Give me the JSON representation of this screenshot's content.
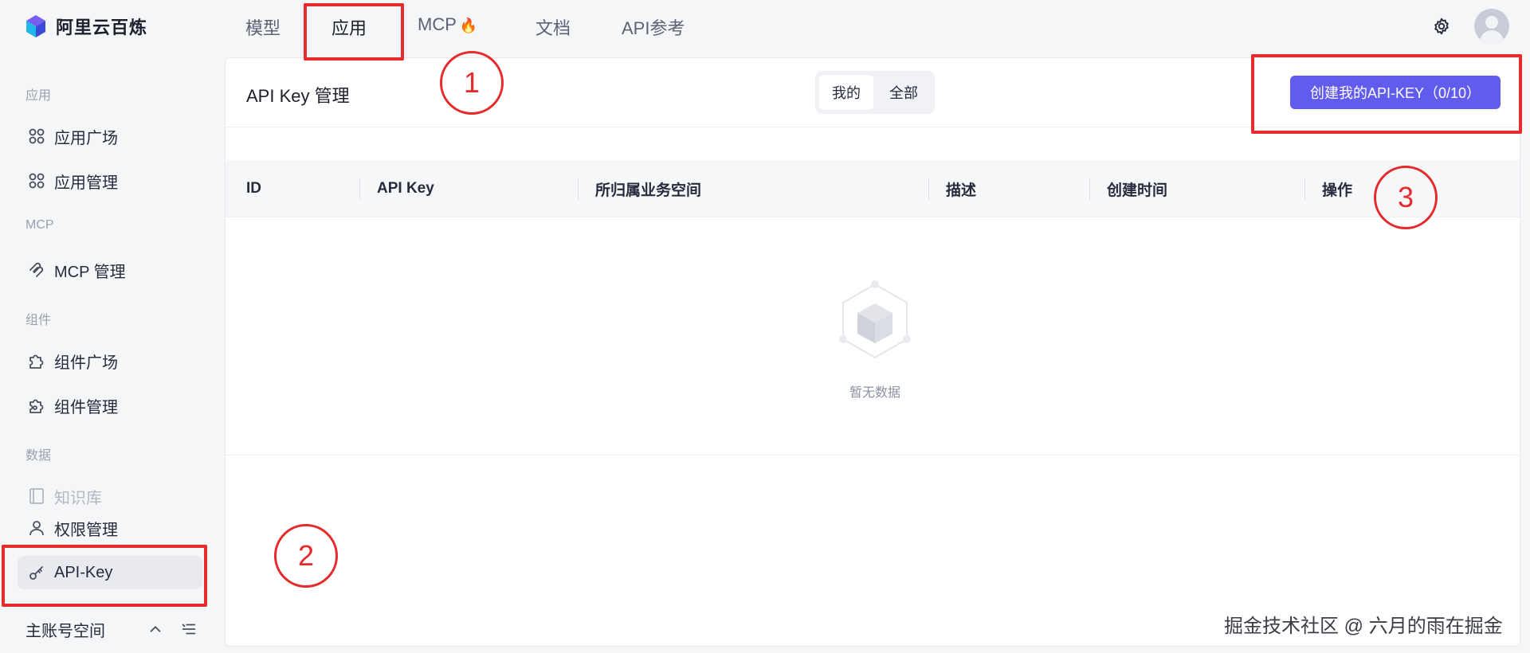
{
  "app": {
    "name": "阿里云百炼"
  },
  "topnav": {
    "tabs": [
      {
        "label": "模型",
        "active": false
      },
      {
        "label": "应用",
        "active": true
      },
      {
        "label": "MCP",
        "badge_icon": "fire-icon",
        "active": false
      },
      {
        "label": "文档",
        "active": false
      },
      {
        "label": "API参考",
        "active": false
      }
    ]
  },
  "sidebar": {
    "sections": [
      {
        "label": "应用",
        "items": [
          {
            "label": "应用广场",
            "icon": "grid-icon"
          },
          {
            "label": "应用管理",
            "icon": "grid-icon"
          }
        ]
      },
      {
        "label": "MCP",
        "items": [
          {
            "label": "MCP 管理",
            "icon": "mcp-icon"
          }
        ]
      },
      {
        "label": "组件",
        "items": [
          {
            "label": "组件广场",
            "icon": "puzzle-icon"
          },
          {
            "label": "组件管理",
            "icon": "puzzle-gear-icon"
          }
        ]
      },
      {
        "label": "数据",
        "items": [
          {
            "label": "知识库",
            "icon": "book-icon",
            "disabled": true
          },
          {
            "label": "权限管理",
            "icon": "user-icon"
          },
          {
            "label": "API-Key",
            "icon": "key-icon",
            "active": true
          }
        ]
      }
    ],
    "footer": {
      "label": "主账号空间"
    }
  },
  "main": {
    "title": "API Key 管理",
    "filter": {
      "options": [
        "我的",
        "全部"
      ],
      "selected": "我的"
    },
    "create_button": "创建我的API-KEY（0/10）",
    "table": {
      "columns": [
        "ID",
        "API Key",
        "所归属业务空间",
        "描述",
        "创建时间",
        "操作"
      ],
      "rows": []
    },
    "empty_text": "暂无数据"
  },
  "annotations": {
    "labels": [
      "1",
      "2",
      "3"
    ],
    "color": "#e52b2b"
  },
  "watermark": "掘金技术社区 @ 六月的雨在掘金",
  "colors": {
    "primary": "#615ced",
    "annotation": "#e52b2b",
    "background": "#f5f6f8"
  }
}
